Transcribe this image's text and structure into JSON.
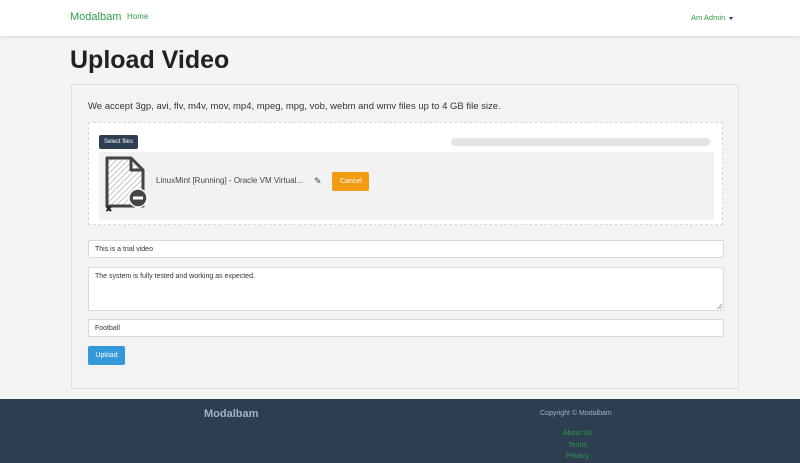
{
  "navbar": {
    "brand": "Modalbam",
    "home": "Home",
    "user": "Am Admin"
  },
  "page": {
    "title": "Upload Video"
  },
  "upload": {
    "accept_text": "We accept 3gp, avi, flv, m4v, mov, mp4, mpeg, mpg, vob, webm and wmv files up to 4 GB file size.",
    "select_files_label": "Select files",
    "progress_fraction": 0,
    "file": {
      "name": "LinuxMint [Running] - Oracle VM Virtual...",
      "remove_glyph": "✖",
      "edit_glyph": "✎",
      "cancel_label": "Cancel"
    }
  },
  "form": {
    "title_value": "This is a trial video",
    "description_value": "The system is fully tested and working as expected.",
    "tags_value": "Football",
    "upload_label": "Upload"
  },
  "footer": {
    "brand": "Modalbam",
    "copyright": "Copyright © Modalbam",
    "links": [
      "About Us",
      "Terms",
      "Privacy"
    ]
  },
  "colors": {
    "accent_green": "#2e9e4a",
    "dark_navy": "#2c3e50",
    "cancel_orange": "#f39c12",
    "upload_blue": "#3498db"
  },
  "icons": {
    "file_thumbnail": "file-placeholder-icon",
    "remove": "close-icon",
    "edit": "pencil-icon",
    "caret": "caret-down-icon"
  }
}
